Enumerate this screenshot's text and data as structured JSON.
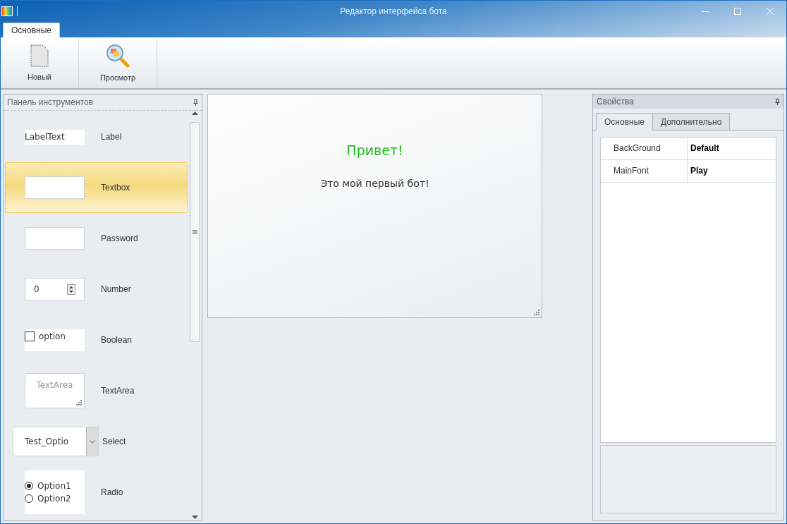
{
  "window": {
    "title": "Редактор интерфейса бота"
  },
  "ribbon": {
    "tabs": [
      {
        "label": "Основные",
        "selected": true
      }
    ],
    "buttons": [
      {
        "kind": "new",
        "label": "Новый"
      },
      {
        "kind": "preview",
        "label": "Просмотр"
      }
    ]
  },
  "toolbox": {
    "title": "Панель инструментов",
    "items": [
      {
        "kind": "label",
        "name": "Label",
        "selected": false,
        "sample": "LabelText"
      },
      {
        "kind": "textbox",
        "name": "Textbox",
        "selected": true
      },
      {
        "kind": "password",
        "name": "Password",
        "selected": false
      },
      {
        "kind": "number",
        "name": "Number",
        "selected": false,
        "value": "0"
      },
      {
        "kind": "boolean",
        "name": "Boolean",
        "selected": false,
        "option": "option",
        "checked": false
      },
      {
        "kind": "textarea",
        "name": "TextArea",
        "selected": false,
        "placeholder": "TextArea"
      },
      {
        "kind": "select",
        "name": "Select",
        "selected": false,
        "value": "Test_Optio"
      },
      {
        "kind": "radio",
        "name": "Radio",
        "selected": false,
        "options": [
          {
            "label": "Option1",
            "selected": true
          },
          {
            "label": "Option2",
            "selected": false
          }
        ]
      }
    ]
  },
  "canvas": {
    "heading": "Привет!",
    "text": "Это мой первый бот!"
  },
  "properties": {
    "title": "Свойства",
    "tabs": [
      {
        "label": "Основные",
        "selected": true
      },
      {
        "label": "Дополнительно",
        "selected": false
      }
    ],
    "rows": [
      {
        "name": "BackGround",
        "value": "Default"
      },
      {
        "name": "MainFont",
        "value": "Play"
      }
    ]
  }
}
